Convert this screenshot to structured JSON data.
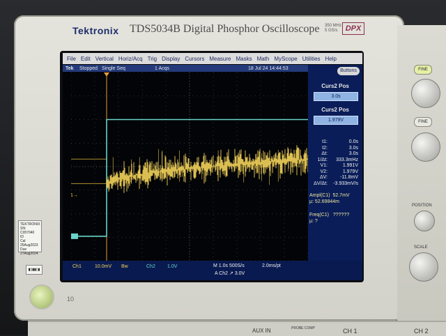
{
  "brand": "Tektronix",
  "model": "TDS5034B Digital Phosphor Oscilloscope",
  "spec_lines": [
    "350 MHz",
    "5 GS/s"
  ],
  "dpx": "DPX",
  "menu": [
    "File",
    "Edit",
    "Vertical",
    "Horiz/Acq",
    "Trig",
    "Display",
    "Cursors",
    "Measure",
    "Masks",
    "Math",
    "MyScope",
    "Utilities",
    "Help"
  ],
  "status": {
    "brand": "Tek",
    "state": "Stopped",
    "mode": "Single Seq",
    "acqs": "1 Acqs",
    "datetime": "18 Jul 24 14:44:53"
  },
  "buttons_label": "Buttons",
  "curs2_pos_title": "Curs2 Pos",
  "curs2_pos_value": "3.0s",
  "curs2_pos_title_2": "Curs2 Pos",
  "curs2_pos_value_2": "1.979V",
  "cursor_readout": [
    {
      "k": "t1:",
      "v": "0.0s"
    },
    {
      "k": "t2:",
      "v": "3.0s"
    },
    {
      "k": "Δt:",
      "v": "3.0s"
    },
    {
      "k": "1/Δt:",
      "v": "333.3mHz"
    },
    {
      "k": "V1:",
      "v": "1.991V"
    },
    {
      "k": "V2:",
      "v": "1.979V"
    },
    {
      "k": "ΔV:",
      "v": "-11.8mV"
    },
    {
      "k": "ΔV/Δt:",
      "v": "-3.933mV/s"
    }
  ],
  "meas1": {
    "label": "Ampl(C1)",
    "value": "52.7mV",
    "mu": "μ: 52.69844m"
  },
  "meas2": {
    "label": "Freq(C1)",
    "value": "??????",
    "mu": "μ: ?"
  },
  "bottom": {
    "ch1": "Ch1",
    "ch1_scale": "10.0mV",
    "bw": "Bw",
    "ch2": "Ch2",
    "ch2_scale": "1.0V",
    "timebase": "M 1.0s 500S/s",
    "sample": "2.0ms/pt",
    "trigger": "A  Ch2  ↗  3.0V"
  },
  "channel_markers": {
    "ch1": "1→",
    "ch2": "2→"
  },
  "calibration_tag": {
    "lines": [
      "TEKTRONIX",
      "SN: C057040",
      "ID",
      "Cal",
      "25Aug2023",
      "Due",
      "27Aug2024"
    ]
  },
  "panel": {
    "fine1": "FINE",
    "fine2": "FINE",
    "position": "POSITION",
    "scale": "SCALE",
    "aux": "AUX IN",
    "probe": "PROBE COMP",
    "ch1": "CH 1",
    "ch2": "CH 2"
  },
  "bezel_marking": "10",
  "colors": {
    "ch1": "#f3d35a",
    "ch2": "#69d4c9",
    "readout_bg": "#0a1d58",
    "grid": "#5a5a5a"
  },
  "waveform": {
    "ch2_low_fraction": 0.87,
    "ch2_high_fraction": 0.25,
    "ch1_step_time_div": 1.5,
    "noise_level": 0.34
  }
}
